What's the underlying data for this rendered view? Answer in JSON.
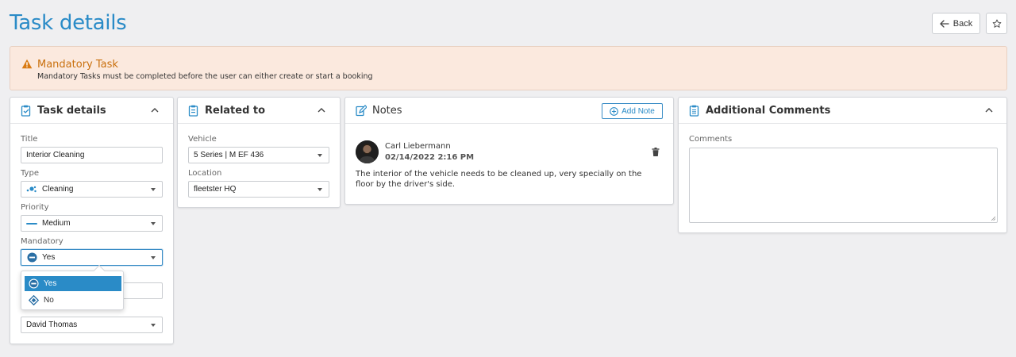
{
  "page": {
    "title": "Task details"
  },
  "header": {
    "back_label": "Back"
  },
  "alert": {
    "title": "Mandatory Task",
    "text": "Mandatory Tasks must be completed before the user can either create or start a booking"
  },
  "task_details": {
    "title": "Task details",
    "fields": {
      "title_label": "Title",
      "title_value": "Interior Cleaning",
      "type_label": "Type",
      "type_value": "Cleaning",
      "priority_label": "Priority",
      "priority_value": "Medium",
      "mandatory_label": "Mandatory",
      "mandatory_value": "Yes",
      "assignee_value": "David Thomas"
    },
    "mandatory_options": [
      "Yes",
      "No"
    ]
  },
  "related": {
    "title": "Related to",
    "vehicle_label": "Vehicle",
    "vehicle_value": "5 Series | M EF 436",
    "location_label": "Location",
    "location_value": "fleetster HQ"
  },
  "notes": {
    "title": "Notes",
    "add_label": "Add Note",
    "items": [
      {
        "author": "Carl Liebermann",
        "date": "02/14/2022 2:16 PM",
        "text": "The interior of the vehicle needs to be cleaned up, very specially on the floor by the driver's side."
      }
    ]
  },
  "comments": {
    "title": "Additional Comments",
    "label": "Comments",
    "value": ""
  },
  "colors": {
    "accent": "#2a8bc7",
    "warning_bg": "#fbe9de",
    "warning_text": "#c9700e"
  },
  "icons": {
    "back": "arrow-left-icon",
    "favorite": "star-icon",
    "alert": "warning-triangle-icon",
    "task": "clipboard-check-icon",
    "related": "clipboard-icon",
    "notes": "edit-note-icon",
    "comments": "clipboard-list-icon",
    "collapse": "chevron-up-icon",
    "add": "plus-circle-icon",
    "delete": "trash-icon"
  }
}
